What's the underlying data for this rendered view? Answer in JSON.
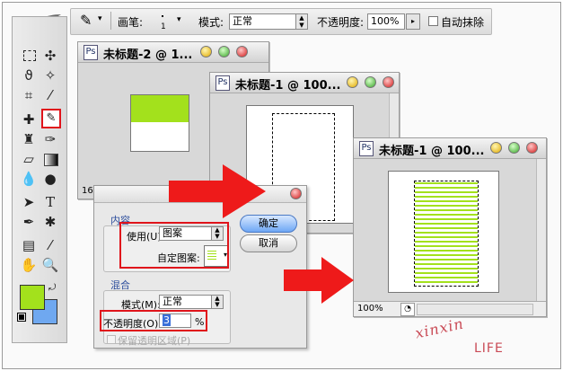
{
  "options_bar": {
    "brush_label": "画笔:",
    "brush_size": "1",
    "mode_label": "模式:",
    "mode_value": "正常",
    "opacity_label": "不透明度:",
    "opacity_value": "100%",
    "auto_erase_label": "自动抹除"
  },
  "windows": {
    "back": {
      "title": "未标题-2 @ 1..."
    },
    "middle": {
      "title": "未标题-1 @ 100..."
    },
    "front": {
      "title": "未标题-1 @ 100...",
      "zoom": "100%"
    },
    "back_zoom_partial": "16"
  },
  "dialog": {
    "content_section": "内容",
    "use_label": "使用(U):",
    "use_value": "图案",
    "custom_pattern_label": "自定图案:",
    "ok_button": "确定",
    "cancel_button": "取消",
    "blending_section": "混合",
    "mode_label": "模式(M):",
    "mode_value": "正常",
    "opacity_label": "不透明度(O):",
    "opacity_value": "3",
    "opacity_unit": "%",
    "preserve_label": "保留透明区域(P)"
  },
  "toolbox": {
    "foreground_color": "#a3e11c",
    "background_color": "#6fa8f0"
  },
  "watermark": {
    "signature": "xinxin",
    "life": "LIFE"
  },
  "colors": {
    "highlight_red": "#e0141b",
    "pattern_green": "#a3e11c"
  }
}
